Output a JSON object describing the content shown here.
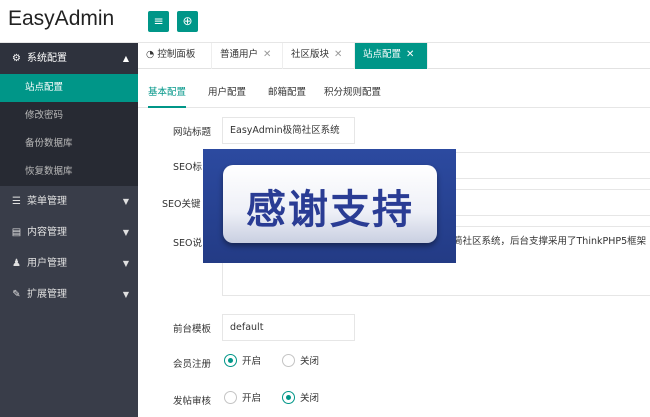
{
  "app": {
    "title": "EasyAdmin"
  },
  "toolbar": {
    "menu_icon": "≡",
    "refresh_icon": "⊕"
  },
  "sidebar": {
    "system": {
      "label": "系统配置",
      "icon": "gear-icon"
    },
    "system_items": [
      {
        "label": "站点配置",
        "active": true
      },
      {
        "label": "修改密码"
      },
      {
        "label": "备份数据库"
      },
      {
        "label": "恢复数据库"
      }
    ],
    "menus": [
      {
        "label": "菜单管理",
        "icon": "list-icon"
      },
      {
        "label": "内容管理",
        "icon": "file-icon"
      },
      {
        "label": "用户管理",
        "icon": "users-icon"
      },
      {
        "label": "扩展管理",
        "icon": "wrench-icon"
      }
    ]
  },
  "tabs": [
    {
      "label": "控制面板",
      "icon": "dashboard-icon"
    },
    {
      "label": "普通用户",
      "closable": true
    },
    {
      "label": "社区版块",
      "closable": true
    },
    {
      "label": "站点配置",
      "closable": true,
      "active": true
    }
  ],
  "subtabs": [
    {
      "label": "基本配置",
      "active": true
    },
    {
      "label": "用户配置"
    },
    {
      "label": "邮箱配置"
    },
    {
      "label": "积分规则配置"
    }
  ],
  "form": {
    "site_title": {
      "label": "网站标题",
      "value": "EasyAdmin极简社区系统"
    },
    "seo_title": {
      "label": "SEO标"
    },
    "seo_keywords": {
      "label": "SEO关键"
    },
    "seo_desc": {
      "label": "SEO说",
      "value": "简社区系统，后台支撑采用了ThinkPHP5框架"
    },
    "template": {
      "label": "前台模板",
      "value": "default"
    },
    "register": {
      "label": "会员注册",
      "options": [
        "开启",
        "关闭"
      ],
      "selected": "开启"
    },
    "post_review": {
      "label": "发帖审核",
      "options": [
        "开启",
        "关闭"
      ],
      "selected": "关闭"
    }
  },
  "overlay": {
    "text": "感谢支持"
  },
  "colors": {
    "accent": "#009688",
    "sidebar_bg": "#393d49",
    "overlay_bg": "#2c4aa0"
  }
}
